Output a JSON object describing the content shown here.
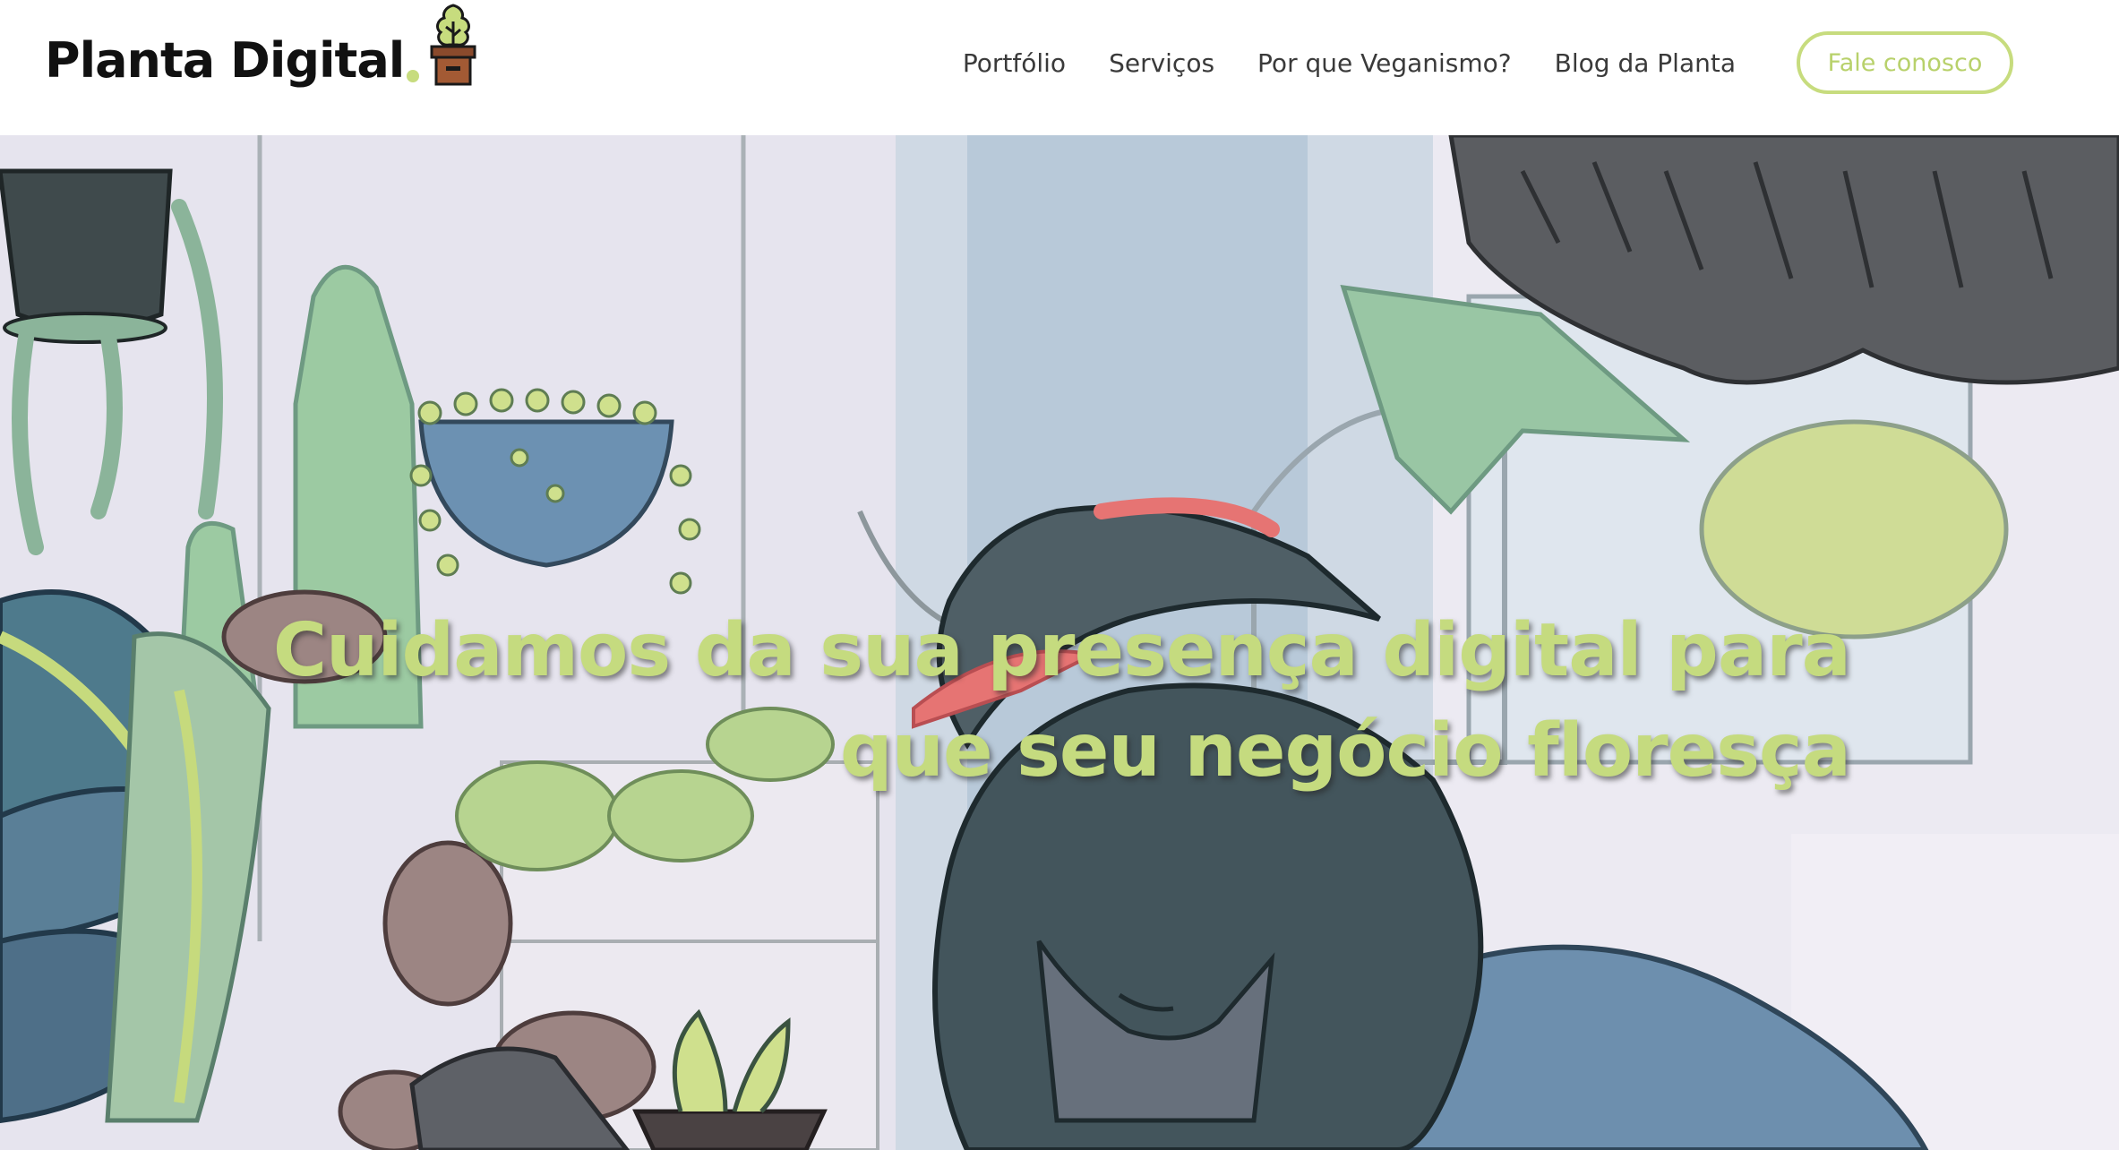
{
  "brand": {
    "name": "Planta Digital",
    "accent": "#c7dc7e",
    "logo_icon": "potted-plant-icon"
  },
  "nav": {
    "items": [
      {
        "label": "Portfólio"
      },
      {
        "label": "Serviços"
      },
      {
        "label": "Por que Veganismo?"
      },
      {
        "label": "Blog da Planta"
      }
    ],
    "cta_label": "Fale conosco"
  },
  "hero": {
    "headline_lines": [
      "Cuidamos da sua presença digital para",
      "que seu negócio floresça"
    ],
    "headline_color": "#c5db7f",
    "illustration": "person-tending-plants-illustration"
  }
}
